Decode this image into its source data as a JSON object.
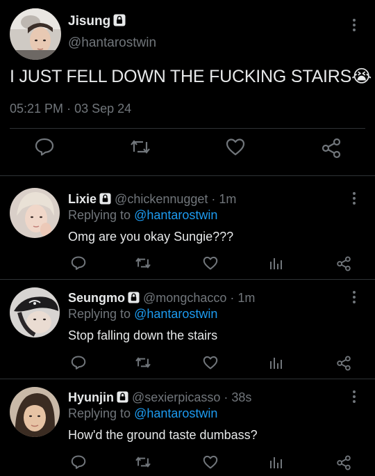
{
  "main_tweet": {
    "name": "Jisung",
    "handle": "@hantarostwin",
    "text": "I JUST FELL DOWN THE FUCKING STAIRS",
    "emoji": "😭",
    "time": "05:21 PM",
    "separator": "·",
    "date": "03 Sep 24"
  },
  "replies": [
    {
      "name": "Lixie",
      "handle": "@chickennugget",
      "age": "1m",
      "replying_prefix": "Replying to",
      "replying_to": "@hantarostwin",
      "text": "Omg are you okay Sungie???"
    },
    {
      "name": "Seungmo",
      "handle": "@mongchacco",
      "age": "1m",
      "replying_prefix": "Replying to",
      "replying_to": "@hantarostwin",
      "text": "Stop falling down the stairs"
    },
    {
      "name": "Hyunjin",
      "handle": "@sexierpicasso",
      "age": "38s",
      "replying_prefix": "Replying to",
      "replying_to": "@hantarostwin",
      "text": "How'd the ground taste dumbass?"
    }
  ],
  "icons": [
    "reply-icon",
    "retweet-icon",
    "like-icon",
    "analytics-icon",
    "share-icon",
    "lock-icon",
    "more-icon"
  ],
  "colors": {
    "background": "#000000",
    "text": "#e7e9ea",
    "muted": "#71767b",
    "link": "#1d9bf0",
    "divider": "#2f3336"
  }
}
